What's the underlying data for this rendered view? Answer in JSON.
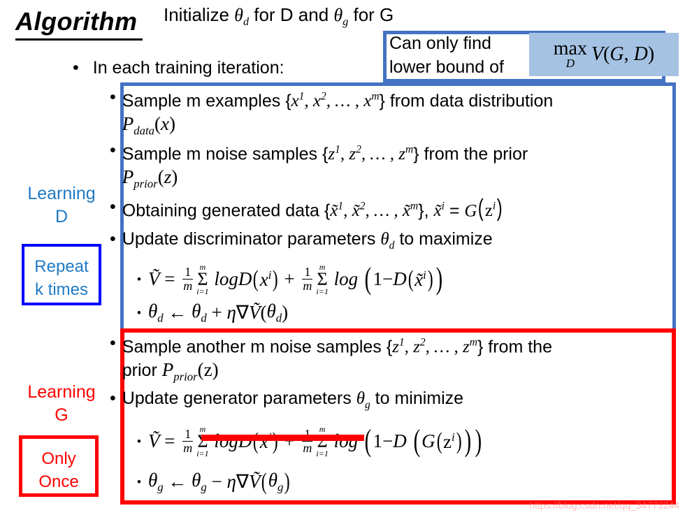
{
  "slide": {
    "title": "Algorithm",
    "init_line": "Initialize θd for D and θg for G",
    "iteration_line": "In each training iteration:",
    "bullet_glyph": "•",
    "sub_bullet_glyph": "•",
    "watermark": "https://blog.csdn.net/qq_34773244"
  },
  "callout": {
    "text_line1": "Can only find",
    "text_line2": "lower bound of",
    "formula": "max_D V(G, D)",
    "formula_max": "max",
    "formula_sub": "D",
    "formula_rest": "V(G, D)",
    "border_color": "#4472C4",
    "formula_bg": "#a5c2e3"
  },
  "learning_d": {
    "label_line1": "Learning",
    "label_line2": "D",
    "note_line1": "Repeat",
    "note_line2": "k times",
    "color": "#1F7AC4",
    "border_color": "#4472C4",
    "note_border_color": "#0000FF",
    "steps": [
      {
        "id": "sample-examples",
        "line1_a": "Sample m examples {",
        "line1_math": "x1, x2, …, xm",
        "line1_b": "} from data distribution",
        "line2": "Pdata(x)"
      },
      {
        "id": "sample-noise",
        "line1_a": "Sample m noise samples {",
        "line1_math": "z1, z2, …, zm",
        "line1_b": "} from the prior",
        "line2": "Pprior(z)"
      },
      {
        "id": "obtain-generated",
        "line1_a": "Obtaining generated data {",
        "line1_math": "x̃1, x̃2, …, x̃m",
        "line1_b": "}, x̃i = G(zi)"
      },
      {
        "id": "update-discriminator",
        "line1_a": "Update discriminator parameters θd to maximize"
      }
    ],
    "formulas": [
      {
        "id": "v-tilde-d",
        "text": "Ṽ = 1/m Σ i=1..m logD(xi) + 1/m Σ i=1..m log(1 − D(x̃i))"
      },
      {
        "id": "theta-d-update",
        "text": "θd ← θd + η∇Ṽ(θd)"
      }
    ]
  },
  "learning_g": {
    "label_line1": "Learning",
    "label_line2": "G",
    "note_line1": "Only",
    "note_line2": "Once",
    "color": "#FF0000",
    "border_color": "#FF0000",
    "steps": [
      {
        "id": "sample-another-noise",
        "line1_a": "Sample another m noise samples {",
        "line1_math": "z1, z2, …, zm",
        "line1_b": "} from the",
        "line2": "prior Pprior(z)"
      },
      {
        "id": "update-generator",
        "line1_a": "Update generator parameters θg to minimize"
      }
    ],
    "formulas": [
      {
        "id": "v-tilde-g",
        "text": "Ṽ = 1/m Σ i=1..m logD(xi) + 1/m Σ i=1..m log(1 − D(G(zi)))",
        "struck_term": "1/m Σ i=1..m logD(xi)"
      },
      {
        "id": "theta-g-update",
        "text": "θg ← θg − η∇Ṽ(θg)"
      }
    ]
  },
  "labels": {
    "title_text": "Algorithm"
  }
}
